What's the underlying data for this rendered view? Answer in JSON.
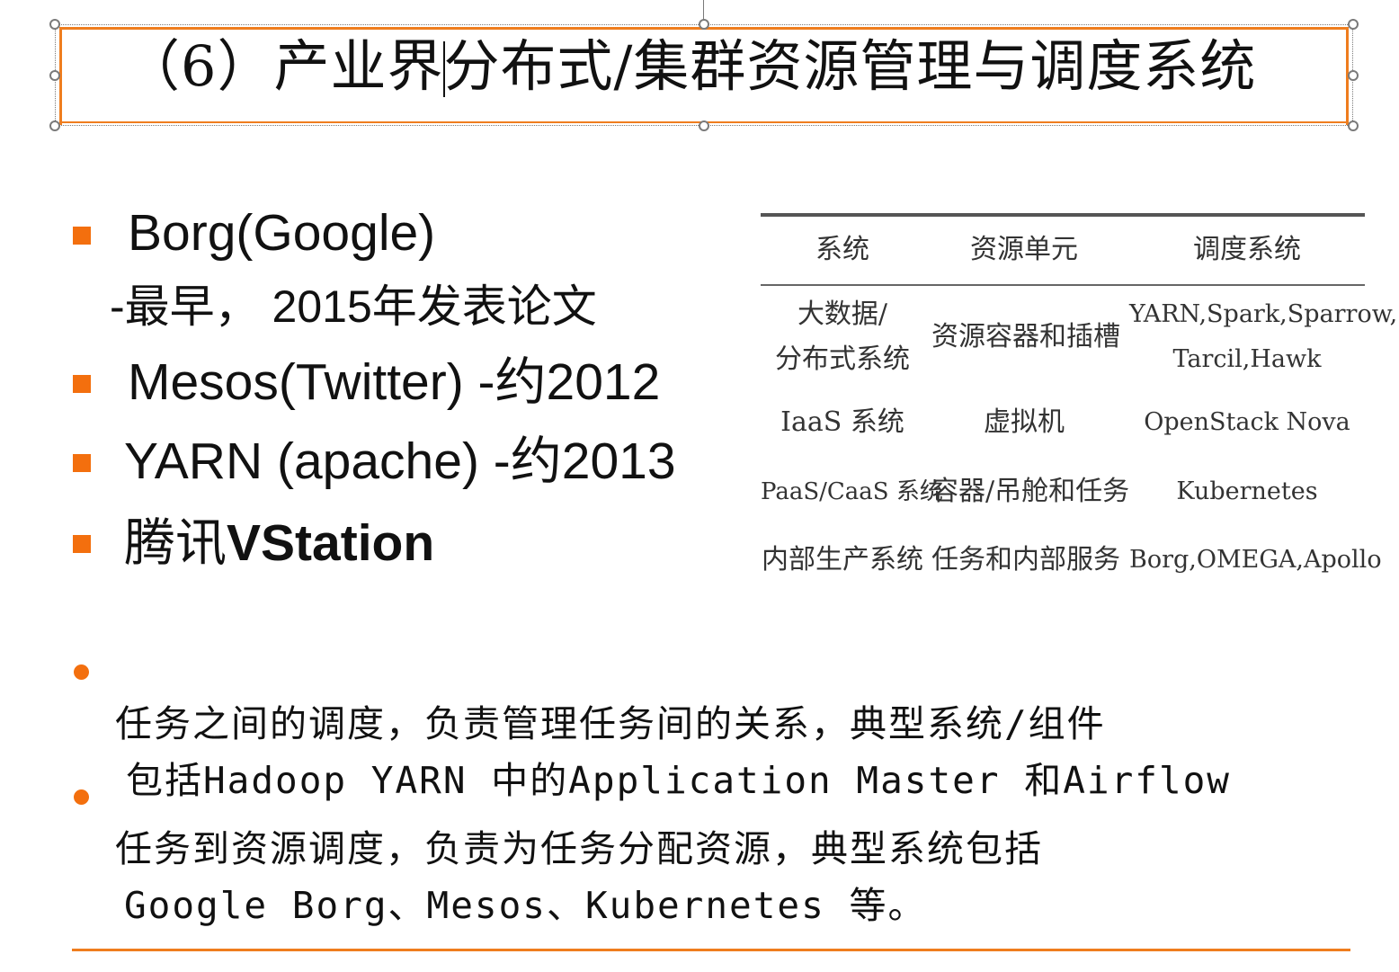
{
  "slide": {
    "title": "（6）产业界分布式/集群资源管理与调度系统"
  },
  "bullets": {
    "borg": "Borg(Google)",
    "borg_note": "-最早， 2015年发表论文",
    "mesos": "Mesos(Twitter) -约2012",
    "yarn": "YARN (apache) -约2013",
    "vstation_prefix": "腾讯",
    "vstation_bold": "VStation"
  },
  "table": {
    "headers": [
      "系统",
      "资源单元",
      "调度系统"
    ],
    "rows": [
      {
        "system_line1": "大数据/",
        "system_line2": "分布式系统",
        "unit": "资源容器和插槽",
        "sched_line1": "YARN,Spark,Sparrow,",
        "sched_line2": "Tarcil,Hawk"
      },
      {
        "system": "IaaS 系统",
        "unit": "虚拟机",
        "sched": "OpenStack Nova"
      },
      {
        "system": "PaaS/CaaS 系统",
        "unit": "容器/吊舱和任务",
        "sched": "Kubernetes"
      },
      {
        "system": "内部生产系统",
        "unit": "任务和内部服务",
        "sched": "Borg,OMEGA,Apollo"
      }
    ]
  },
  "paragraphs": {
    "p1_line1": "任务之间的调度，负责管理任务间的关系，典型系统/组件",
    "p1_line2": "包括Hadoop YARN 中的Application Master 和Airflow",
    "p2_line1": "任务到资源调度，负责为任务分配资源，典型系统包括",
    "p2_line2": "Google Borg、Mesos、Kubernetes 等。"
  },
  "colors": {
    "accent": "#f36f0e",
    "text": "#111111"
  }
}
